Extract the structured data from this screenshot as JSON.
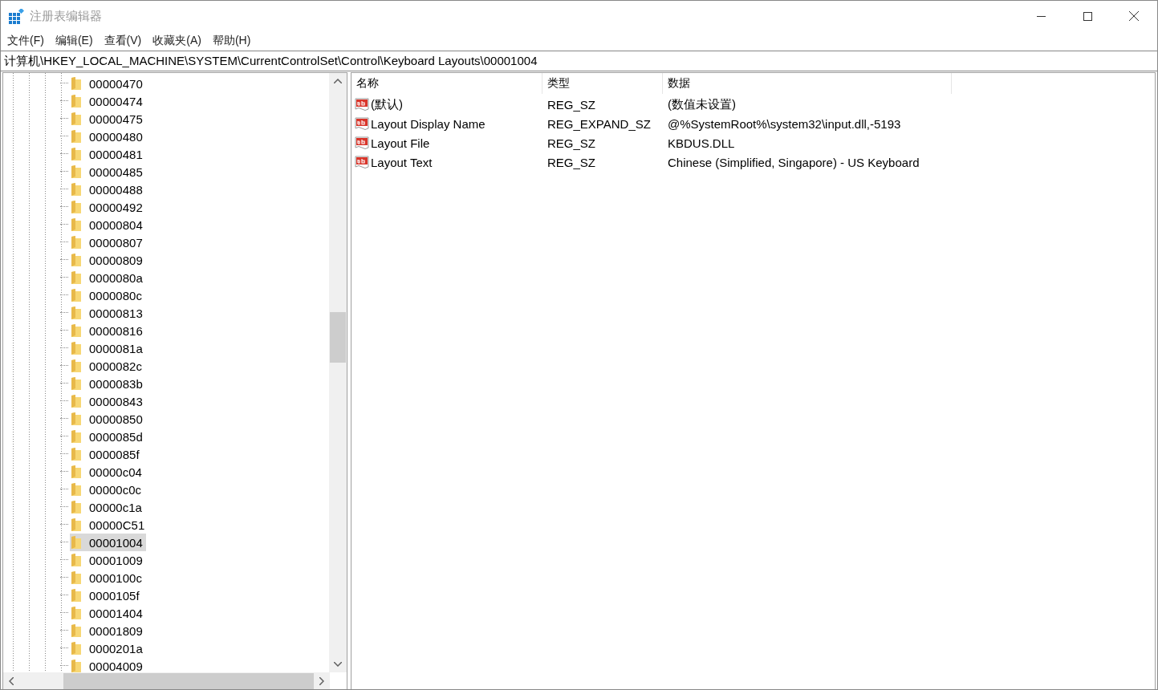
{
  "window": {
    "title": "注册表编辑器"
  },
  "menu": [
    "文件(F)",
    "编辑(E)",
    "查看(V)",
    "收藏夹(A)",
    "帮助(H)"
  ],
  "address": "计算机\\HKEY_LOCAL_MACHINE\\SYSTEM\\CurrentControlSet\\Control\\Keyboard Layouts\\00001004",
  "tree_items": [
    {
      "label": "00000470",
      "selected": false
    },
    {
      "label": "00000474",
      "selected": false
    },
    {
      "label": "00000475",
      "selected": false
    },
    {
      "label": "00000480",
      "selected": false
    },
    {
      "label": "00000481",
      "selected": false
    },
    {
      "label": "00000485",
      "selected": false
    },
    {
      "label": "00000488",
      "selected": false
    },
    {
      "label": "00000492",
      "selected": false
    },
    {
      "label": "00000804",
      "selected": false
    },
    {
      "label": "00000807",
      "selected": false
    },
    {
      "label": "00000809",
      "selected": false
    },
    {
      "label": "0000080a",
      "selected": false
    },
    {
      "label": "0000080c",
      "selected": false
    },
    {
      "label": "00000813",
      "selected": false
    },
    {
      "label": "00000816",
      "selected": false
    },
    {
      "label": "0000081a",
      "selected": false
    },
    {
      "label": "0000082c",
      "selected": false
    },
    {
      "label": "0000083b",
      "selected": false
    },
    {
      "label": "00000843",
      "selected": false
    },
    {
      "label": "00000850",
      "selected": false
    },
    {
      "label": "0000085d",
      "selected": false
    },
    {
      "label": "0000085f",
      "selected": false
    },
    {
      "label": "00000c04",
      "selected": false
    },
    {
      "label": "00000c0c",
      "selected": false
    },
    {
      "label": "00000c1a",
      "selected": false
    },
    {
      "label": "00000C51",
      "selected": false
    },
    {
      "label": "00001004",
      "selected": true
    },
    {
      "label": "00001009",
      "selected": false
    },
    {
      "label": "0000100c",
      "selected": false
    },
    {
      "label": "0000105f",
      "selected": false
    },
    {
      "label": "00001404",
      "selected": false
    },
    {
      "label": "00001809",
      "selected": false
    },
    {
      "label": "0000201a",
      "selected": false
    },
    {
      "label": "00004009",
      "selected": false
    }
  ],
  "values": {
    "columns": [
      "名称",
      "类型",
      "数据"
    ],
    "rows": [
      {
        "name": "(默认)",
        "type": "REG_SZ",
        "data": "(数值未设置)"
      },
      {
        "name": "Layout Display Name",
        "type": "REG_EXPAND_SZ",
        "data": "@%SystemRoot%\\system32\\input.dll,-5193"
      },
      {
        "name": "Layout File",
        "type": "REG_SZ",
        "data": "KBDUS.DLL"
      },
      {
        "name": "Layout Text",
        "type": "REG_SZ",
        "data": "Chinese (Simplified, Singapore) - US Keyboard"
      }
    ]
  }
}
